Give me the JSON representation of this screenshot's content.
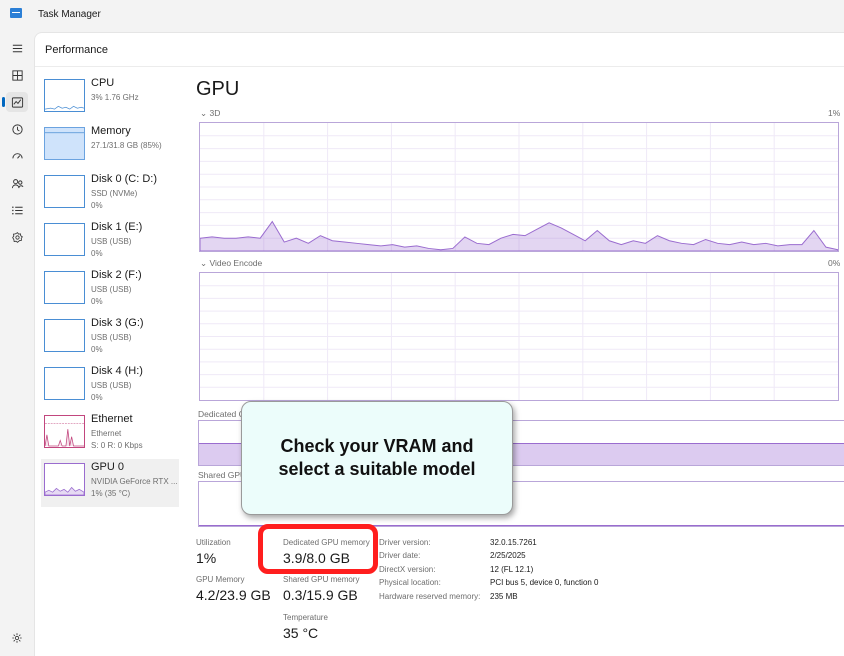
{
  "window": {
    "title": "Task Manager"
  },
  "header": {
    "title": "Performance"
  },
  "nav": {
    "items": [
      {
        "name": "hamburger-menu-icon"
      },
      {
        "name": "processes-icon"
      },
      {
        "name": "performance-icon",
        "active": true
      },
      {
        "name": "app-history-icon"
      },
      {
        "name": "startup-apps-icon"
      },
      {
        "name": "users-icon"
      },
      {
        "name": "details-icon"
      },
      {
        "name": "services-icon"
      }
    ],
    "settings": "settings-icon"
  },
  "devices": [
    {
      "name": "CPU",
      "line1": "3%  1.76 GHz",
      "line2": ""
    },
    {
      "name": "Memory",
      "line1": "27.1/31.8 GB (85%)",
      "line2": ""
    },
    {
      "name": "Disk 0 (C: D:)",
      "line1": "SSD (NVMe)",
      "line2": "0%"
    },
    {
      "name": "Disk 1 (E:)",
      "line1": "USB (USB)",
      "line2": "0%"
    },
    {
      "name": "Disk 2 (F:)",
      "line1": "USB (USB)",
      "line2": "0%"
    },
    {
      "name": "Disk 3 (G:)",
      "line1": "USB (USB)",
      "line2": "0%"
    },
    {
      "name": "Disk 4 (H:)",
      "line1": "USB (USB)",
      "line2": "0%"
    },
    {
      "name": "Ethernet",
      "line1": "Ethernet",
      "line2": "S: 0  R: 0 Kbps"
    },
    {
      "name": "GPU 0",
      "line1": "NVIDIA GeForce RTX ...",
      "line2": "1%  (35 °C)"
    }
  ],
  "gpu": {
    "title": "GPU",
    "graphs": {
      "engine1_label": "3D",
      "engine1_value": "1%",
      "engine2_label": "Video Encode",
      "engine2_value": "0%",
      "dedicated_label": "Dedicated GP",
      "shared_label": "Shared GPU",
      "engine1_series": [
        0.1,
        0.11,
        0.1,
        0.1,
        0.11,
        0.1,
        0.23,
        0.07,
        0.1,
        0.06,
        0.12,
        0.08,
        0.07,
        0.06,
        0.05,
        0.04,
        0.05,
        0.03,
        0.04,
        0.02,
        0.01,
        0.02,
        0.11,
        0.06,
        0.05,
        0.1,
        0.13,
        0.12,
        0.17,
        0.22,
        0.18,
        0.13,
        0.08,
        0.16,
        0.08,
        0.05,
        0.08,
        0.06,
        0.12,
        0.08,
        0.06,
        0.05,
        0.09,
        0.06,
        0.05,
        0.07,
        0.05,
        0.06,
        0.04,
        0.05,
        0.05,
        0.16,
        0.03,
        0.01
      ],
      "dedicated_fill": 0.49,
      "shared_fill": 0.02
    },
    "stats": {
      "utilization_label": "Utilization",
      "utilization_value": "1%",
      "dedicated_label": "Dedicated GPU memory",
      "dedicated_value": "3.9/8.0 GB",
      "gpu_memory_label": "GPU Memory",
      "gpu_memory_value": "4.2/23.9 GB",
      "shared_label": "Shared GPU memory",
      "shared_value": "0.3/15.9 GB",
      "temp_label": "Temperature",
      "temp_value": "35 °C"
    },
    "info": [
      {
        "label": "Driver version:",
        "value": "32.0.15.7261"
      },
      {
        "label": "Driver date:",
        "value": "2/25/2025"
      },
      {
        "label": "DirectX version:",
        "value": "12 (FL 12.1)"
      },
      {
        "label": "Physical location:",
        "value": "PCI bus 5, device 0, function 0"
      },
      {
        "label": "Hardware reserved memory:",
        "value": "235 MB"
      }
    ]
  },
  "callout": {
    "text": "Check your VRAM and select a suitable model"
  },
  "colors": {
    "accent": "#0067c0",
    "gpu": "#9a6ccf",
    "highlight": "#ff1e1e"
  }
}
